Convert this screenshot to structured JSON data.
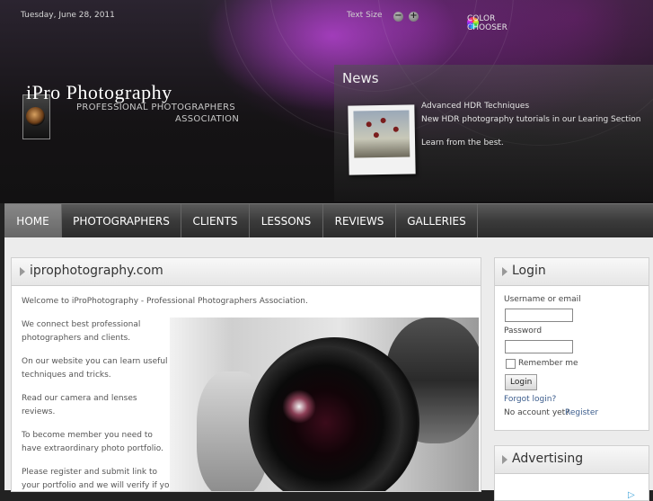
{
  "topbar": {
    "date": "Tuesday, June 28, 2011",
    "text_size_label": "Text Size",
    "decrease_symbol": "−",
    "increase_symbol": "+",
    "color_chooser_label": "COLOR CHOOSER"
  },
  "logo": {
    "title": "iPro Photography",
    "subtitle_line1": "PROFESSIONAL PHOTOGRAPHERS",
    "subtitle_line2": "ASSOCIATION"
  },
  "news": {
    "title": "News",
    "headline": "Advanced HDR Techniques",
    "text": "New HDR photography tutorials in our Learing Section",
    "tagline": "Learn from the best."
  },
  "nav": {
    "items": [
      {
        "label": "HOME",
        "active": true
      },
      {
        "label": "PHOTOGRAPHERS",
        "active": false
      },
      {
        "label": "CLIENTS",
        "active": false
      },
      {
        "label": "LESSONS",
        "active": false
      },
      {
        "label": "REVIEWS",
        "active": false
      },
      {
        "label": "GALLERIES",
        "active": false
      }
    ]
  },
  "main": {
    "title": "iprophotography.com",
    "welcome": "Welcome to iProPhotography - Professional Photographers Association.",
    "paragraphs": [
      [
        "We connect best professional",
        "photographers and clients."
      ],
      [
        "On our website you can learn useful",
        "techniques and tricks."
      ],
      [
        "Read our camera and lenses",
        "reviews."
      ],
      [
        "To become member you need to",
        "have extraordinary photo portfolio."
      ],
      [
        "Please register and submit link to",
        "your portfolio and we will verify if you"
      ]
    ]
  },
  "login": {
    "title": "Login",
    "username_label": "Username or email",
    "password_label": "Password",
    "remember_label": "Remember me",
    "submit_label": "Login",
    "forgot_label": "Forgot login?",
    "no_account_label": "No account yet?",
    "register_label": "Register"
  },
  "advertising": {
    "title": "Advertising"
  },
  "colors": {
    "accent_purple": "#8e2fb0",
    "nav_bg": "#3a3a3a",
    "link_blue": "#3b5c8c"
  }
}
